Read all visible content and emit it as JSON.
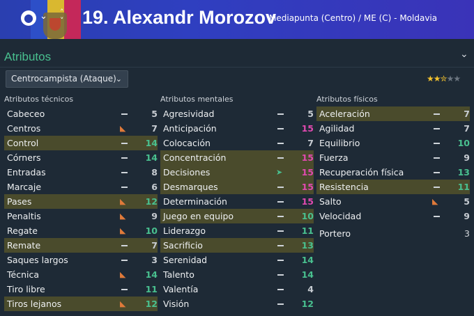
{
  "header": {
    "title": "19. Alexandr Morozov",
    "subtitle": "Mediapunta (Centro) / ME (C) - Moldavia",
    "globe_icon": "globe-icon",
    "flag_colors": [
      "#2d4fc8",
      "#d9b830",
      "#c4285a"
    ]
  },
  "section": {
    "title": "Atributos",
    "role_selected": "Centrocampista (Ataque)",
    "rating_stars": 2.5,
    "rating_max": 5
  },
  "colors": {
    "accent_green": "#49c08f",
    "highlight_row": "#4a4b2c",
    "pink_value": "#e04ab0",
    "star": "#f2c12e"
  },
  "tecnicos": {
    "header": "Atributos técnicos",
    "rows": [
      {
        "name": "Cabeceo",
        "value": "5",
        "mark": "dash",
        "tone": "grey",
        "hl": false
      },
      {
        "name": "Centros",
        "value": "7",
        "mark": "down",
        "tone": "grey",
        "hl": false
      },
      {
        "name": "Control",
        "value": "14",
        "mark": "dash",
        "tone": "green",
        "hl": true
      },
      {
        "name": "Córners",
        "value": "14",
        "mark": "dash",
        "tone": "green",
        "hl": false
      },
      {
        "name": "Entradas",
        "value": "8",
        "mark": "dash",
        "tone": "grey",
        "hl": false
      },
      {
        "name": "Marcaje",
        "value": "6",
        "mark": "dash",
        "tone": "grey",
        "hl": false
      },
      {
        "name": "Pases",
        "value": "12",
        "mark": "down",
        "tone": "green",
        "hl": true
      },
      {
        "name": "Penaltis",
        "value": "9",
        "mark": "down",
        "tone": "grey",
        "hl": false
      },
      {
        "name": "Regate",
        "value": "10",
        "mark": "down",
        "tone": "green",
        "hl": false
      },
      {
        "name": "Remate",
        "value": "7",
        "mark": "dash",
        "tone": "grey",
        "hl": true
      },
      {
        "name": "Saques largos",
        "value": "3",
        "mark": "dash",
        "tone": "grey",
        "hl": false
      },
      {
        "name": "Técnica",
        "value": "14",
        "mark": "down",
        "tone": "green",
        "hl": false
      },
      {
        "name": "Tiro libre",
        "value": "11",
        "mark": "dash",
        "tone": "green",
        "hl": false
      },
      {
        "name": "Tiros lejanos",
        "value": "12",
        "mark": "down",
        "tone": "green",
        "hl": true
      }
    ]
  },
  "mentales": {
    "header": "Atributos mentales",
    "rows": [
      {
        "name": "Agresividad",
        "value": "5",
        "mark": "dash",
        "tone": "grey",
        "hl": false
      },
      {
        "name": "Anticipación",
        "value": "15",
        "mark": "dash",
        "tone": "pink",
        "hl": false
      },
      {
        "name": "Colocación",
        "value": "7",
        "mark": "dash",
        "tone": "grey",
        "hl": false
      },
      {
        "name": "Concentración",
        "value": "15",
        "mark": "dash",
        "tone": "pink",
        "hl": true
      },
      {
        "name": "Decisiones",
        "value": "15",
        "mark": "up",
        "tone": "pink",
        "hl": true
      },
      {
        "name": "Desmarques",
        "value": "15",
        "mark": "dash",
        "tone": "pink",
        "hl": true
      },
      {
        "name": "Determinación",
        "value": "15",
        "mark": "dash",
        "tone": "pink",
        "hl": false
      },
      {
        "name": "Juego en equipo",
        "value": "10",
        "mark": "dash",
        "tone": "green",
        "hl": true
      },
      {
        "name": "Liderazgo",
        "value": "11",
        "mark": "dash",
        "tone": "green",
        "hl": false
      },
      {
        "name": "Sacrificio",
        "value": "13",
        "mark": "dash",
        "tone": "green",
        "hl": true
      },
      {
        "name": "Serenidad",
        "value": "14",
        "mark": "dash",
        "tone": "green",
        "hl": false
      },
      {
        "name": "Talento",
        "value": "14",
        "mark": "dash",
        "tone": "green",
        "hl": false
      },
      {
        "name": "Valentía",
        "value": "4",
        "mark": "dash",
        "tone": "grey",
        "hl": false
      },
      {
        "name": "Visión",
        "value": "12",
        "mark": "dash",
        "tone": "green",
        "hl": false
      }
    ]
  },
  "fisicos": {
    "header": "Atributos físicos",
    "rows": [
      {
        "name": "Aceleración",
        "value": "7",
        "mark": "dash",
        "tone": "grey",
        "hl": true
      },
      {
        "name": "Agilidad",
        "value": "7",
        "mark": "dash",
        "tone": "grey",
        "hl": false
      },
      {
        "name": "Equilibrio",
        "value": "10",
        "mark": "dash",
        "tone": "green",
        "hl": false
      },
      {
        "name": "Fuerza",
        "value": "9",
        "mark": "dash",
        "tone": "grey",
        "hl": false
      },
      {
        "name": "Recuperación física",
        "value": "13",
        "mark": "dash",
        "tone": "green",
        "hl": false
      },
      {
        "name": "Resistencia",
        "value": "11",
        "mark": "dash",
        "tone": "green",
        "hl": true
      },
      {
        "name": "Salto",
        "value": "5",
        "mark": "down",
        "tone": "grey",
        "hl": false
      },
      {
        "name": "Velocidad",
        "value": "9",
        "mark": "dash",
        "tone": "grey",
        "hl": false
      }
    ],
    "goalkeeper": {
      "name": "Portero",
      "value": "3"
    }
  }
}
